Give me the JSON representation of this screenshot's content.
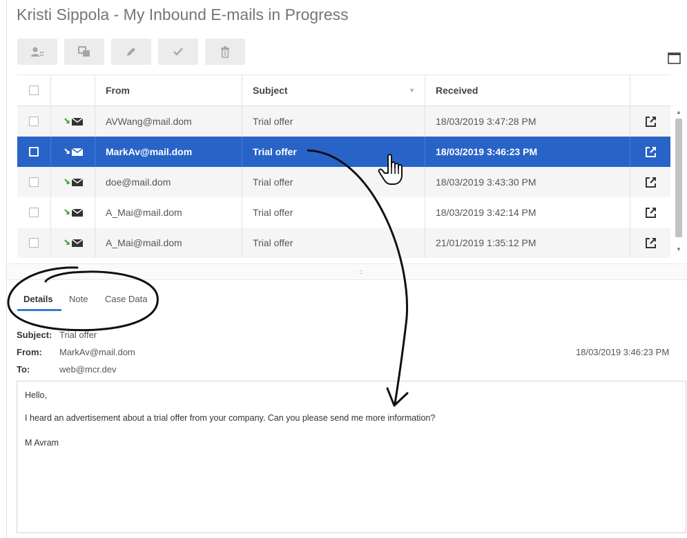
{
  "window": {
    "title": "Kristi Sippola - My Inbound E-mails in Progress"
  },
  "toolbar": {
    "buttons": [
      {
        "icon": "mark-done-person-icon"
      },
      {
        "icon": "transfer-icon"
      },
      {
        "icon": "pencil-edit-icon"
      },
      {
        "icon": "checkmark-icon"
      },
      {
        "icon": "trash-icon"
      }
    ],
    "maximize_icon": "maximize-window-icon"
  },
  "grid": {
    "columns": [
      "From",
      "Subject",
      "Received"
    ],
    "rows": [
      {
        "from": "AVWang@mail.dom",
        "subject": "Trial offer",
        "received": "18/03/2019 3:47:28 PM",
        "selected": false
      },
      {
        "from": "MarkAv@mail.dom",
        "subject": "Trial offer",
        "received": "18/03/2019 3:46:23 PM",
        "selected": true
      },
      {
        "from": "doe@mail.dom",
        "subject": "Trial offer",
        "received": "18/03/2019 3:43:30 PM",
        "selected": false
      },
      {
        "from": "A_Mai@mail.dom",
        "subject": "Trial offer",
        "received": "18/03/2019 3:42:14 PM",
        "selected": false
      },
      {
        "from": "A_Mai@mail.dom",
        "subject": "Trial offer",
        "received": "21/01/2019 1:35:12 PM",
        "selected": false
      }
    ]
  },
  "tabs": [
    {
      "label": "Details",
      "active": true
    },
    {
      "label": "Note",
      "active": false
    },
    {
      "label": "Case Data",
      "active": false
    }
  ],
  "details": {
    "subject_label": "Subject:",
    "subject_value": "Trial offer",
    "from_label": "From:",
    "from_value": "MarkAv@mail.dom",
    "to_label": "To:",
    "to_value": "web@mcr.dev",
    "date": "18/03/2019 3:46:23 PM",
    "body": [
      "Hello,",
      "I heard an advertisement about a trial offer from your company. Can you please send me more information?",
      "M Avram"
    ]
  },
  "colors": {
    "selection": "#2864c8",
    "tab_accent": "#3a78d6",
    "inbound_arrow": "#3aa83a"
  }
}
